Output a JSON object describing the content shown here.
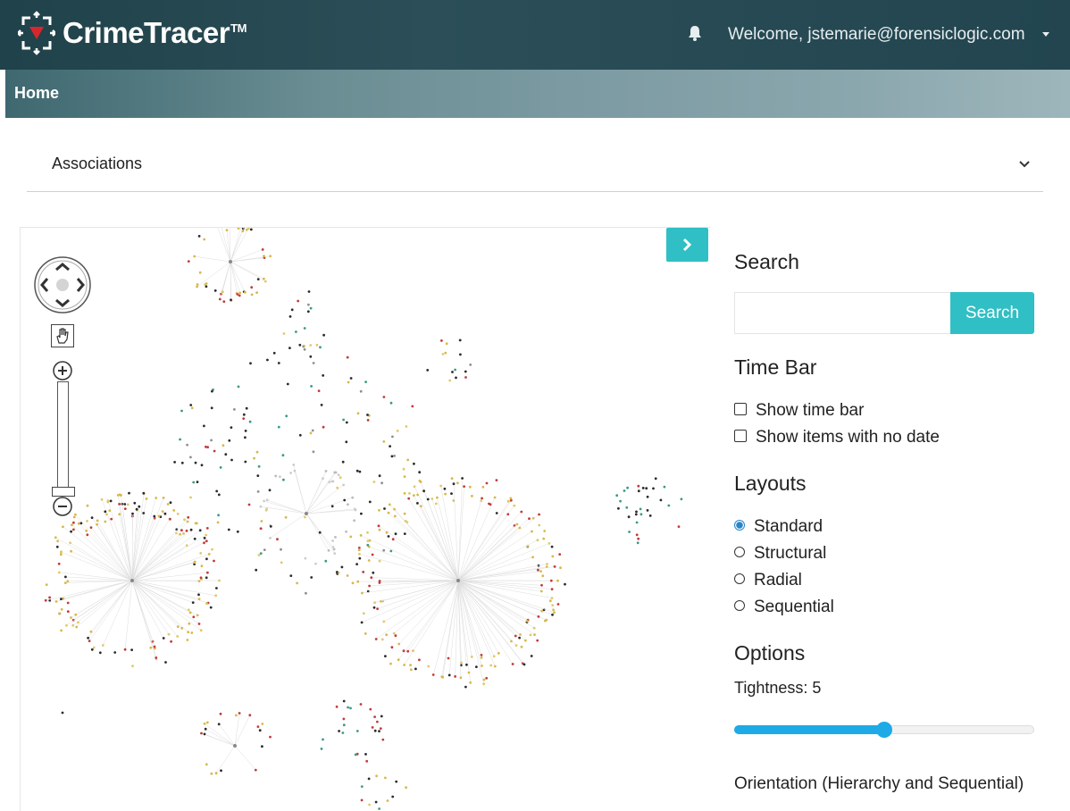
{
  "header": {
    "brand": "CrimeTracer",
    "trademark": "TM",
    "welcome": "Welcome, jstemarie@forensiclogic.com",
    "bell_icon": "bell-icon",
    "logo_icon": "crimetracer-logo-icon"
  },
  "nav": {
    "home": "Home"
  },
  "section": {
    "title": "Associations"
  },
  "panel": {
    "search": {
      "heading": "Search",
      "input_value": "",
      "button": "Search"
    },
    "time_bar": {
      "heading": "Time Bar",
      "options": [
        {
          "label": "Show time bar",
          "checked": false
        },
        {
          "label": "Show items with no date",
          "checked": false
        }
      ]
    },
    "layouts": {
      "heading": "Layouts",
      "selected": "Standard",
      "options": [
        "Standard",
        "Structural",
        "Radial",
        "Sequential"
      ]
    },
    "options": {
      "heading": "Options",
      "tightness_label": "Tightness: 5",
      "tightness_fraction": 0.5,
      "orientation_label": "Orientation (Hierarchy and Sequential)"
    }
  },
  "colors": {
    "accent": "#30bfc4",
    "slider": "#1eaae6",
    "radio": "#2a85c8",
    "header": "#22454f"
  }
}
